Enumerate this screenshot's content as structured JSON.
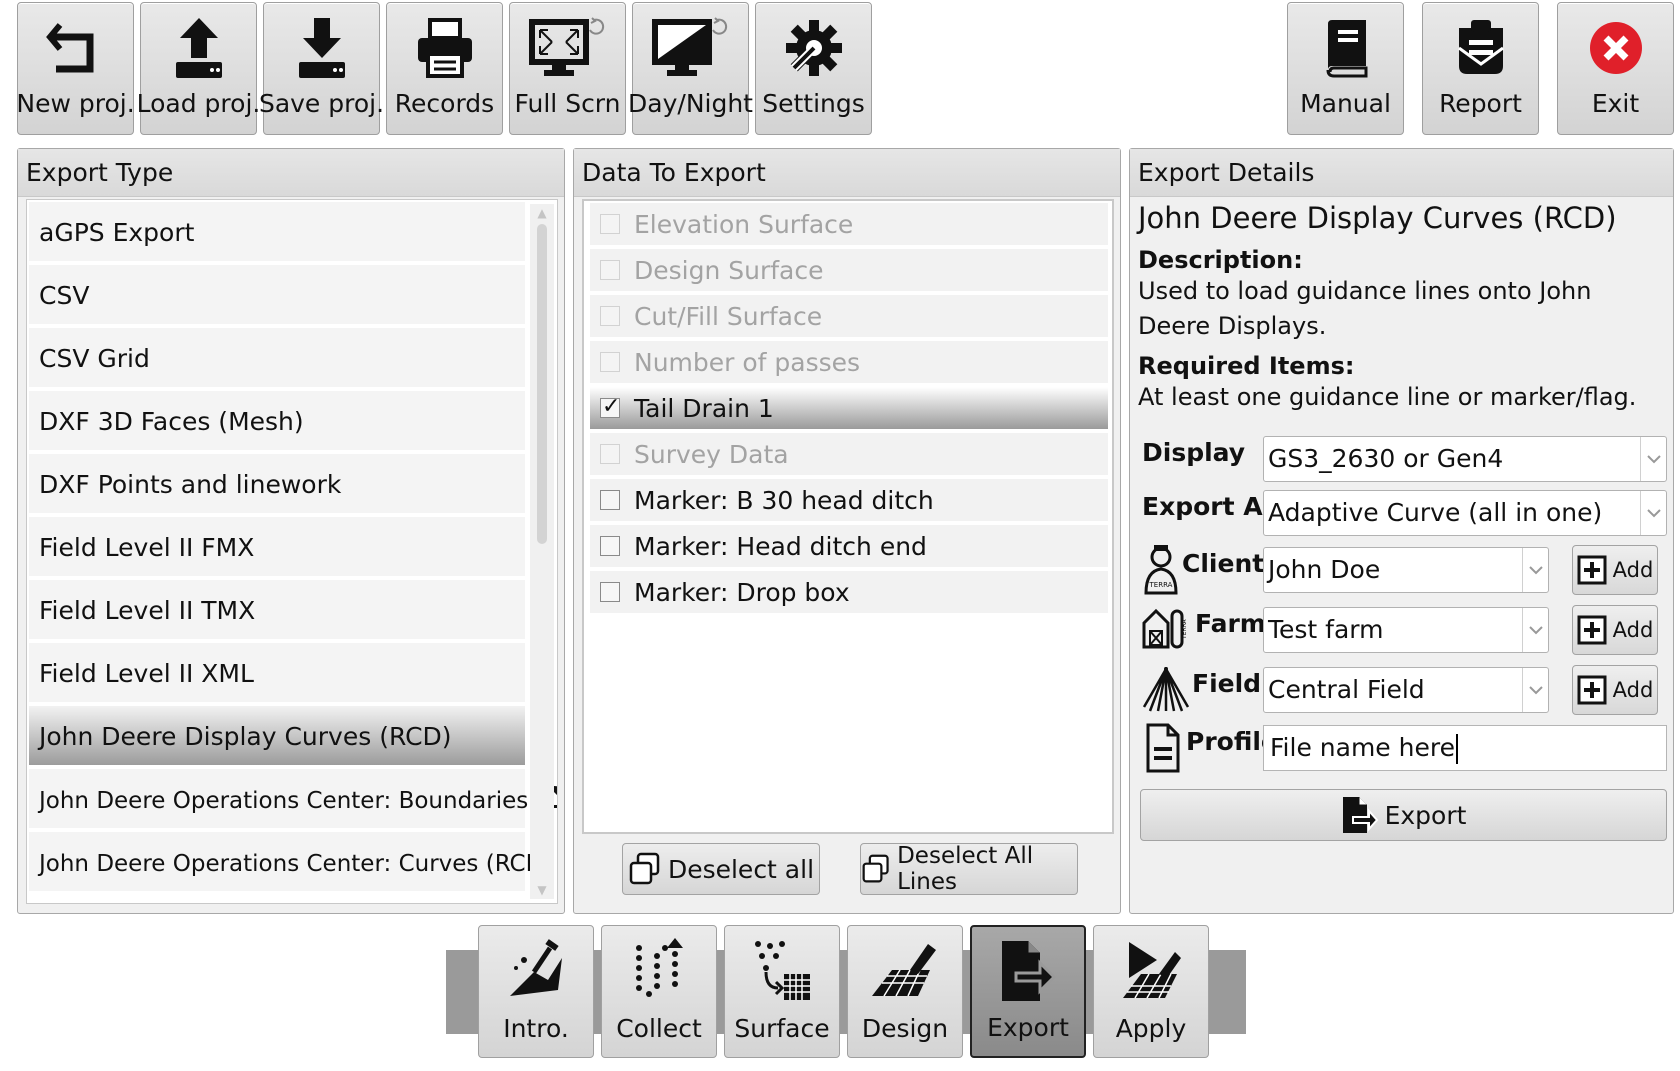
{
  "toolbar": {
    "new": "New proj.",
    "load": "Load proj.",
    "save": "Save proj.",
    "records": "Records",
    "fullscreen": "Full Scrn",
    "daynight": "Day/Night",
    "settings": "Settings",
    "manual": "Manual",
    "report": "Report",
    "exit": "Exit"
  },
  "export_type": {
    "title": "Export Type",
    "items": [
      "aGPS Export",
      "CSV",
      "CSV Grid",
      "DXF 3D Faces (Mesh)",
      "DXF Points and linework",
      "Field Level II FMX",
      "Field Level II TMX",
      "Field Level II XML",
      "John Deere Display Curves (RCD)",
      "John Deere Operations Center: Boundaries",
      "John Deere Operations Center: Curves (RCD)"
    ],
    "selected": "John Deere Display Curves (RCD)"
  },
  "data_to_export": {
    "title": "Data To Export",
    "rows": [
      {
        "label": "Elevation Surface",
        "checked": false,
        "enabled": false
      },
      {
        "label": "Design Surface",
        "checked": false,
        "enabled": false
      },
      {
        "label": "Cut/Fill Surface",
        "checked": false,
        "enabled": false
      },
      {
        "label": "Number of passes",
        "checked": false,
        "enabled": false
      },
      {
        "label": "Tail Drain 1",
        "checked": true,
        "enabled": true
      },
      {
        "label": "Survey Data",
        "checked": false,
        "enabled": false
      },
      {
        "label": "Marker: B 30 head ditch",
        "checked": false,
        "enabled": true
      },
      {
        "label": "Marker: Head ditch end",
        "checked": false,
        "enabled": true
      },
      {
        "label": "Marker: Drop box",
        "checked": false,
        "enabled": true
      }
    ],
    "deselect_all": "Deselect all",
    "deselect_all_lines": "Deselect All Lines"
  },
  "export_details": {
    "title": "Export Details",
    "name": "John Deere Display Curves (RCD)",
    "description_label": "Description:",
    "description": "Used to load guidance lines onto John Deere Displays.",
    "required_label": "Required Items:",
    "required": "At least one guidance line or marker/flag.",
    "display_label": "Display",
    "display_value": "GS3_2630 or Gen4",
    "export_as_label": "Export As",
    "export_as_value": "Adaptive Curve (all in one)",
    "client_label": "Client",
    "client_value": "John Doe",
    "farm_label": "Farm",
    "farm_value": "Test farm",
    "field_label": "Field",
    "field_value": "Central Field",
    "profile_label": "Profile",
    "profile_value": "File name here",
    "add_label": "Add",
    "export_button": "Export"
  },
  "nav": {
    "intro": "Intro.",
    "collect": "Collect",
    "surface": "Surface",
    "design": "Design",
    "export": "Export",
    "apply": "Apply",
    "active": "Export"
  }
}
